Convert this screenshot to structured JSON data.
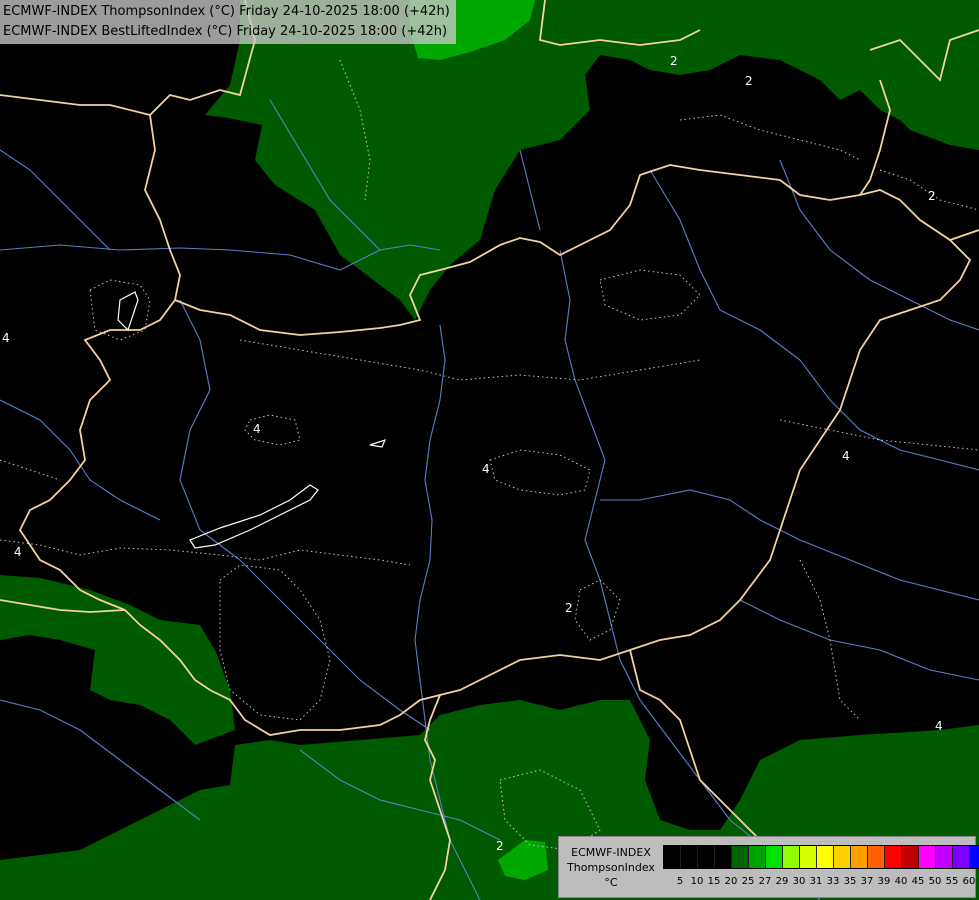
{
  "header": {
    "line1": "ECMWF-INDEX ThompsonIndex (°C) Friday 24-10-2025 18:00 (+42h)",
    "line2": "ECMWF-INDEX BestLiftedIndex (°C) Friday 24-10-2025 18:00 (+42h)"
  },
  "legend": {
    "source": "ECMWF-INDEX",
    "parameter": "ThompsonIndex",
    "unit": "°C",
    "ticks": [
      "5",
      "10",
      "15",
      "20",
      "25",
      "27",
      "29",
      "30",
      "31",
      "33",
      "35",
      "37",
      "39",
      "40",
      "45",
      "50",
      "55",
      "60"
    ],
    "colors": [
      "#000000",
      "#000000",
      "#000000",
      "#000000",
      "#006400",
      "#00a000",
      "#00e000",
      "#90ff00",
      "#d8ff00",
      "#ffff00",
      "#ffd000",
      "#ffa000",
      "#ff6000",
      "#ff0000",
      "#c00000",
      "#ff00ff",
      "#c000ff",
      "#8000ff",
      "#0000ff"
    ]
  },
  "contour_labels": [
    "2",
    "2",
    "2",
    "4",
    "4",
    "4",
    "4",
    "4",
    "4",
    "2",
    "2",
    "4",
    "4"
  ],
  "colors": {
    "background": "#000000",
    "fill_green": "#005a00",
    "fill_bright_green": "#00a800",
    "border": "#f2d2a0",
    "river": "#5c7ec8",
    "contour": "#c8c8c8"
  }
}
